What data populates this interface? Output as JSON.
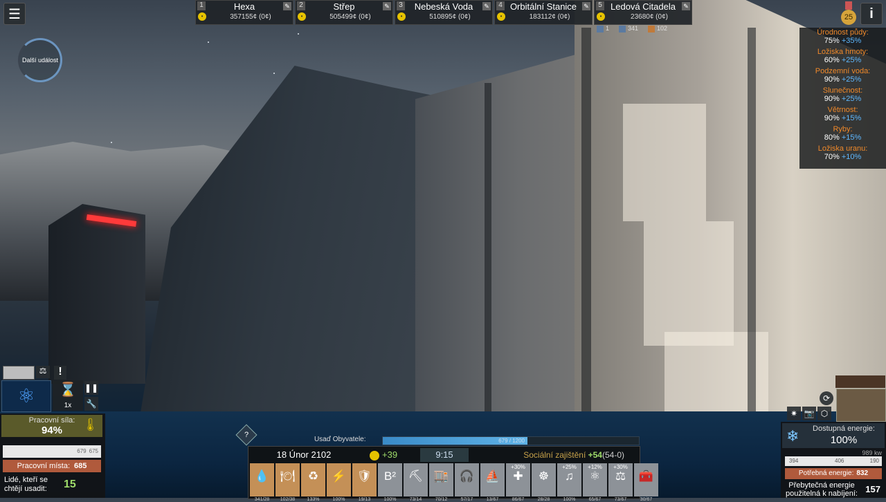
{
  "top": {
    "event_label": "Další událost",
    "colonies": [
      {
        "num": "1",
        "name": "Hexa",
        "money": "357155¢ (0¢)"
      },
      {
        "num": "2",
        "name": "Střep",
        "money": "505499¢ (0¢)"
      },
      {
        "num": "3",
        "name": "Nebeská Voda",
        "money": "510895¢ (0¢)"
      },
      {
        "num": "4",
        "name": "Orbitální Stanice",
        "money": "183112¢ (0¢)"
      },
      {
        "num": "5",
        "name": "Ledová Citadela",
        "money": "23680¢ (0¢)"
      }
    ],
    "sub_resources": [
      "1",
      "341",
      "102"
    ],
    "level": "25",
    "info_label": "i"
  },
  "resources": [
    {
      "name": "Úrodnost půdy:",
      "value": "75%",
      "bonus": "+35%"
    },
    {
      "name": "Ložiska hmoty:",
      "value": "60%",
      "bonus": "+25%"
    },
    {
      "name": "Podzemní voda:",
      "value": "90%",
      "bonus": "+25%"
    },
    {
      "name": "Slunečnost:",
      "value": "90%",
      "bonus": "+25%"
    },
    {
      "name": "Větrnost:",
      "value": "90%",
      "bonus": "+15%"
    },
    {
      "name": "Ryby:",
      "value": "80%",
      "bonus": "+15%"
    },
    {
      "name": "Ložiska uranu:",
      "value": "70%",
      "bonus": "+10%"
    }
  ],
  "left_panel": {
    "speed": "1x",
    "workforce_label": "Pracovní síla:",
    "workforce_value": "94%",
    "worker_counts": [
      "679",
      "675"
    ],
    "jobs_label": "Pracovní místa:",
    "jobs_value": "685",
    "movers_label": "Lidé, kteří se chtějí usadit:",
    "movers_value": "15"
  },
  "bottom": {
    "settle_label": "Usaď Obyvatele:",
    "settle_progress_text": "679 / 1200",
    "settle_fraction": 0.566,
    "date": "18 Únor 2102",
    "happiness": "+39",
    "time": "9:15",
    "social_label": "Sociální zajištění",
    "social_value": "+54",
    "social_detail": "(54-0)",
    "slots": [
      {
        "icon": "water-drop",
        "glyph": "💧",
        "pct": "",
        "count": "341/28",
        "color": "brown"
      },
      {
        "icon": "food-plate",
        "glyph": "🍽",
        "pct": "",
        "count": "102/38",
        "color": "brown"
      },
      {
        "icon": "recycle",
        "glyph": "♻",
        "pct": "",
        "count": "133%",
        "color": "brown"
      },
      {
        "icon": "energy-bolt",
        "glyph": "⚡",
        "pct": "",
        "count": "100%",
        "color": "brown"
      },
      {
        "icon": "security-shield",
        "glyph": "🛡",
        "pct": "",
        "count": "19/13",
        "color": "brown"
      },
      {
        "icon": "education",
        "glyph": "B²",
        "pct": "",
        "count": "100%",
        "color": "grey"
      },
      {
        "icon": "construction",
        "glyph": "⛏",
        "pct": "",
        "count": "73/14",
        "color": "grey"
      },
      {
        "icon": "shop",
        "glyph": "🏬",
        "pct": "",
        "count": "70/12",
        "color": "grey"
      },
      {
        "icon": "headphones",
        "glyph": "🎧",
        "pct": "",
        "count": "57/17",
        "color": "grey"
      },
      {
        "icon": "tourism",
        "glyph": "⛵",
        "pct": "",
        "count": "13/67",
        "color": "grey"
      },
      {
        "icon": "health-cross",
        "glyph": "✚",
        "pct": "+30%",
        "count": "86/67",
        "color": "grey"
      },
      {
        "icon": "steering-wheel",
        "glyph": "☸",
        "pct": "",
        "count": "28/28",
        "color": "grey"
      },
      {
        "icon": "music",
        "glyph": "♫",
        "pct": "+25%",
        "count": "100%",
        "color": "grey"
      },
      {
        "icon": "science-atom",
        "glyph": "⚛",
        "pct": "+12%",
        "count": "65/67",
        "color": "grey"
      },
      {
        "icon": "justice-scale",
        "glyph": "⚖",
        "pct": "+30%",
        "count": "73/67",
        "color": "grey"
      },
      {
        "icon": "medical-kit",
        "glyph": "🧰",
        "pct": "",
        "count": "30/67",
        "color": "grey"
      }
    ]
  },
  "energy": {
    "available_label": "Dostupná energie:",
    "available_value": "100%",
    "kw": "989 kw",
    "bar_values": [
      "394",
      "406",
      "190"
    ],
    "need_label": "Potřebná energie:",
    "need_value": "832",
    "surplus_label": "Přebytečná energie použitelná k nabíjení:",
    "surplus_value": "157"
  }
}
